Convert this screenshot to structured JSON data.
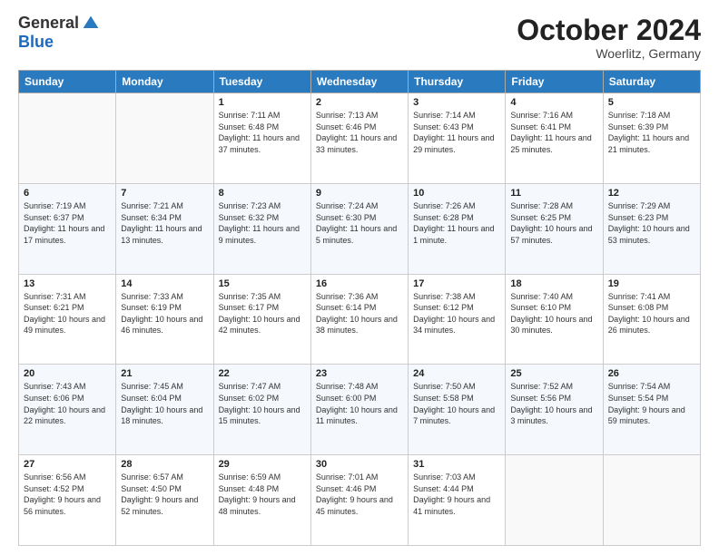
{
  "header": {
    "logo_line1": "General",
    "logo_line2": "Blue",
    "month": "October 2024",
    "location": "Woerlitz, Germany"
  },
  "weekdays": [
    "Sunday",
    "Monday",
    "Tuesday",
    "Wednesday",
    "Thursday",
    "Friday",
    "Saturday"
  ],
  "weeks": [
    [
      {
        "day": "",
        "info": ""
      },
      {
        "day": "",
        "info": ""
      },
      {
        "day": "1",
        "info": "Sunrise: 7:11 AM\nSunset: 6:48 PM\nDaylight: 11 hours and 37 minutes."
      },
      {
        "day": "2",
        "info": "Sunrise: 7:13 AM\nSunset: 6:46 PM\nDaylight: 11 hours and 33 minutes."
      },
      {
        "day": "3",
        "info": "Sunrise: 7:14 AM\nSunset: 6:43 PM\nDaylight: 11 hours and 29 minutes."
      },
      {
        "day": "4",
        "info": "Sunrise: 7:16 AM\nSunset: 6:41 PM\nDaylight: 11 hours and 25 minutes."
      },
      {
        "day": "5",
        "info": "Sunrise: 7:18 AM\nSunset: 6:39 PM\nDaylight: 11 hours and 21 minutes."
      }
    ],
    [
      {
        "day": "6",
        "info": "Sunrise: 7:19 AM\nSunset: 6:37 PM\nDaylight: 11 hours and 17 minutes."
      },
      {
        "day": "7",
        "info": "Sunrise: 7:21 AM\nSunset: 6:34 PM\nDaylight: 11 hours and 13 minutes."
      },
      {
        "day": "8",
        "info": "Sunrise: 7:23 AM\nSunset: 6:32 PM\nDaylight: 11 hours and 9 minutes."
      },
      {
        "day": "9",
        "info": "Sunrise: 7:24 AM\nSunset: 6:30 PM\nDaylight: 11 hours and 5 minutes."
      },
      {
        "day": "10",
        "info": "Sunrise: 7:26 AM\nSunset: 6:28 PM\nDaylight: 11 hours and 1 minute."
      },
      {
        "day": "11",
        "info": "Sunrise: 7:28 AM\nSunset: 6:25 PM\nDaylight: 10 hours and 57 minutes."
      },
      {
        "day": "12",
        "info": "Sunrise: 7:29 AM\nSunset: 6:23 PM\nDaylight: 10 hours and 53 minutes."
      }
    ],
    [
      {
        "day": "13",
        "info": "Sunrise: 7:31 AM\nSunset: 6:21 PM\nDaylight: 10 hours and 49 minutes."
      },
      {
        "day": "14",
        "info": "Sunrise: 7:33 AM\nSunset: 6:19 PM\nDaylight: 10 hours and 46 minutes."
      },
      {
        "day": "15",
        "info": "Sunrise: 7:35 AM\nSunset: 6:17 PM\nDaylight: 10 hours and 42 minutes."
      },
      {
        "day": "16",
        "info": "Sunrise: 7:36 AM\nSunset: 6:14 PM\nDaylight: 10 hours and 38 minutes."
      },
      {
        "day": "17",
        "info": "Sunrise: 7:38 AM\nSunset: 6:12 PM\nDaylight: 10 hours and 34 minutes."
      },
      {
        "day": "18",
        "info": "Sunrise: 7:40 AM\nSunset: 6:10 PM\nDaylight: 10 hours and 30 minutes."
      },
      {
        "day": "19",
        "info": "Sunrise: 7:41 AM\nSunset: 6:08 PM\nDaylight: 10 hours and 26 minutes."
      }
    ],
    [
      {
        "day": "20",
        "info": "Sunrise: 7:43 AM\nSunset: 6:06 PM\nDaylight: 10 hours and 22 minutes."
      },
      {
        "day": "21",
        "info": "Sunrise: 7:45 AM\nSunset: 6:04 PM\nDaylight: 10 hours and 18 minutes."
      },
      {
        "day": "22",
        "info": "Sunrise: 7:47 AM\nSunset: 6:02 PM\nDaylight: 10 hours and 15 minutes."
      },
      {
        "day": "23",
        "info": "Sunrise: 7:48 AM\nSunset: 6:00 PM\nDaylight: 10 hours and 11 minutes."
      },
      {
        "day": "24",
        "info": "Sunrise: 7:50 AM\nSunset: 5:58 PM\nDaylight: 10 hours and 7 minutes."
      },
      {
        "day": "25",
        "info": "Sunrise: 7:52 AM\nSunset: 5:56 PM\nDaylight: 10 hours and 3 minutes."
      },
      {
        "day": "26",
        "info": "Sunrise: 7:54 AM\nSunset: 5:54 PM\nDaylight: 9 hours and 59 minutes."
      }
    ],
    [
      {
        "day": "27",
        "info": "Sunrise: 6:56 AM\nSunset: 4:52 PM\nDaylight: 9 hours and 56 minutes."
      },
      {
        "day": "28",
        "info": "Sunrise: 6:57 AM\nSunset: 4:50 PM\nDaylight: 9 hours and 52 minutes."
      },
      {
        "day": "29",
        "info": "Sunrise: 6:59 AM\nSunset: 4:48 PM\nDaylight: 9 hours and 48 minutes."
      },
      {
        "day": "30",
        "info": "Sunrise: 7:01 AM\nSunset: 4:46 PM\nDaylight: 9 hours and 45 minutes."
      },
      {
        "day": "31",
        "info": "Sunrise: 7:03 AM\nSunset: 4:44 PM\nDaylight: 9 hours and 41 minutes."
      },
      {
        "day": "",
        "info": ""
      },
      {
        "day": "",
        "info": ""
      }
    ]
  ]
}
